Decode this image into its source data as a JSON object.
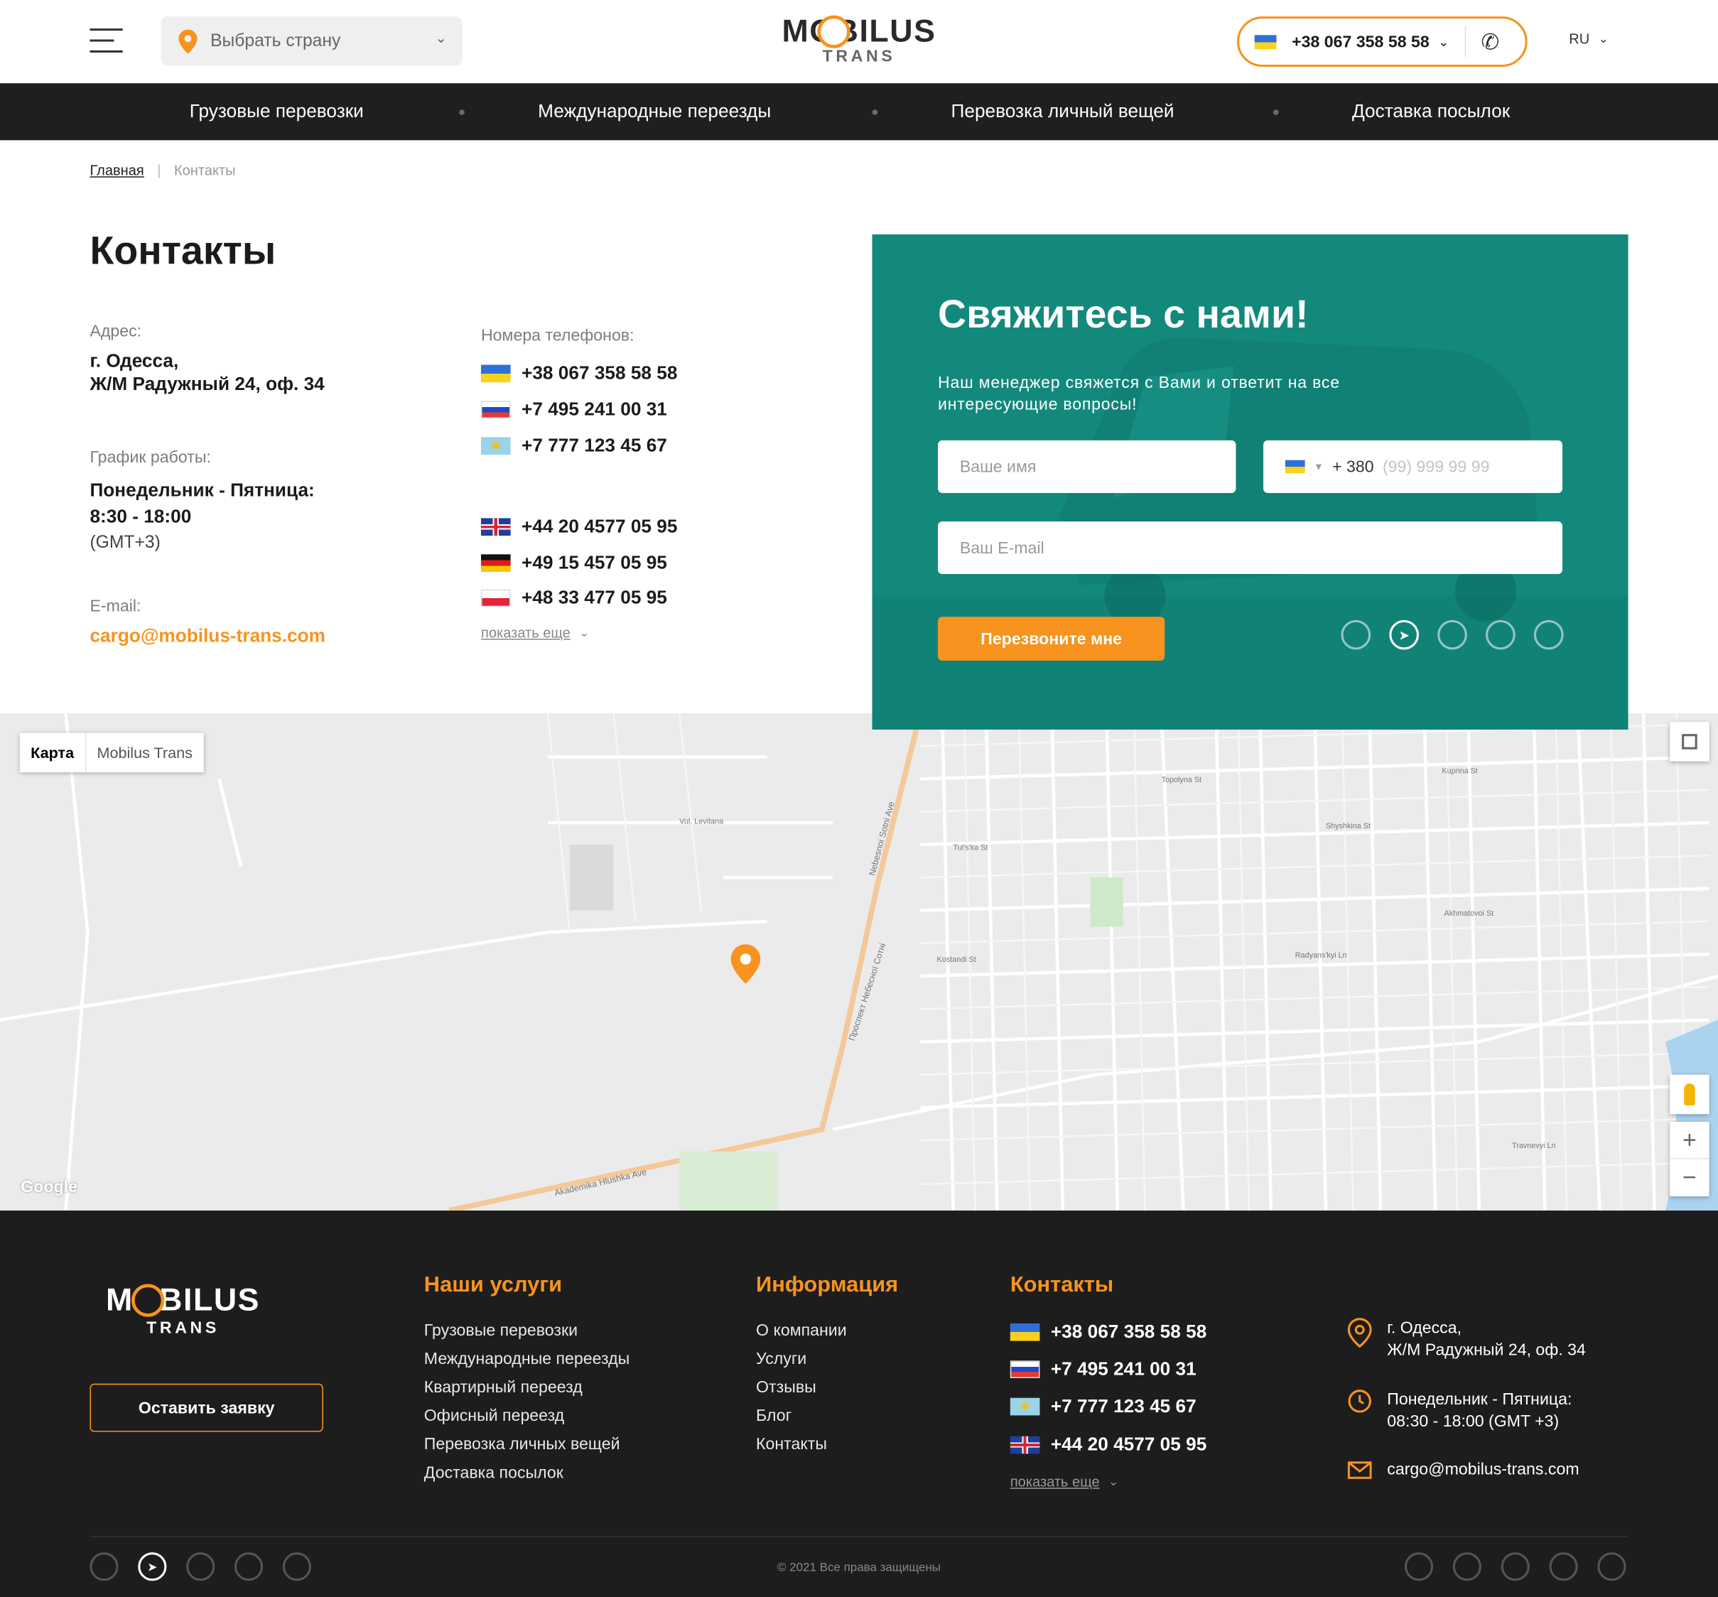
{
  "header": {
    "country_select": "Выбрать страну",
    "logo_main": "MOBILUS",
    "logo_sub": "TRANS",
    "phone": "+38 067 358 58 58",
    "lang": "RU"
  },
  "nav": [
    "Грузовые перевозки",
    "Международные переезды",
    "Перевозка личный вещей",
    "Доставка посылок"
  ],
  "breadcrumb": {
    "home": "Главная",
    "sep": "|",
    "current": "Контакты"
  },
  "page_title": "Контакты",
  "contacts": {
    "address_label": "Адрес:",
    "address_line1": "г. Одесса,",
    "address_line2": "Ж/М Радужный 24, оф. 34",
    "schedule_label": "График работы:",
    "schedule_days": "Понедельник - Пятница:",
    "schedule_hours": "8:30 - 18:00",
    "schedule_tz": "(GMT+3)",
    "email_label": "E-mail:",
    "email": "cargo@mobilus-trans.com",
    "phones_label": "Номера телефонов:",
    "phones": [
      {
        "flag": "ua",
        "number": "+38 067 358 58 58"
      },
      {
        "flag": "ru",
        "number": "+7 495 241 00 31"
      },
      {
        "flag": "kz",
        "number": "+7 777 123 45 67"
      },
      {
        "flag": "uk",
        "number": "+44 20 4577 05 95"
      },
      {
        "flag": "de",
        "number": "+49 15 457 05 95"
      },
      {
        "flag": "pl",
        "number": "+48 33 477 05 95"
      }
    ],
    "show_more": "показать еще"
  },
  "form": {
    "title": "Свяжитесь с нами!",
    "subtitle_line1": "Наш менеджер свяжется с Вами и ответит на все",
    "subtitle_line2": "интересующие вопросы!",
    "name_placeholder": "Ваше имя",
    "phone_prefix": "+ 380",
    "phone_placeholder": "(99) 999 99 99",
    "email_placeholder": "Ваш E-mail",
    "submit": "Перезвоните мне",
    "messengers": [
      "viber-icon",
      "telegram-icon",
      "whatsapp-icon",
      "messenger-icon",
      "skype-icon"
    ]
  },
  "map": {
    "tab_map": "Карта",
    "tab_place": "Mobilus Trans",
    "google": "Google",
    "zoom_in": "+",
    "zoom_out": "−",
    "streets": [
      "Akademika Hlushka Ave",
      "Nebesnoi Sotni Ave",
      "Проспект Небесної Сотні",
      "Akhmatovoi St",
      "Radyans'kyi Ln",
      "Kostandi St",
      "Tul's'ka St",
      "Topolyna St",
      "Vul. Levitana",
      "Travnevyi Ln",
      "Kuprina St",
      "Shyshkina St"
    ]
  },
  "footer": {
    "logo_main": "MOBILUS",
    "logo_sub": "TRANS",
    "cta": "Оставить заявку",
    "services_title": "Наши услуги",
    "services": [
      "Грузовые перевозки",
      "Международные переезды",
      "Квартирный перeезд",
      "Офисный переезд",
      "Перевозка личных вещей",
      "Доставка посылок"
    ],
    "info_title": "Информация",
    "info": [
      "О компании",
      "Услуги",
      "Отзывы",
      "Блог",
      "Контакты"
    ],
    "contacts_title": "Контакты",
    "phones": [
      {
        "flag": "ua",
        "number": "+38 067 358 58 58"
      },
      {
        "flag": "ru",
        "number": "+7 495 241 00 31"
      },
      {
        "flag": "kz",
        "number": "+7 777 123 45 67"
      },
      {
        "flag": "uk",
        "number": "+44 20 4577 05 95"
      }
    ],
    "show_more": "показать еще",
    "address_line1": "г. Одесса,",
    "address_line2": "Ж/М Радужный 24, оф. 34",
    "schedule_line1": "Понедельник - Пятница:",
    "schedule_line2": "08:30 - 18:00 (GMT +3)",
    "email": "cargo@mobilus-trans.com",
    "copyright": "© 2021 Все права защищены",
    "social": [
      "facebook-icon",
      "instagram-icon",
      "vk-icon",
      "youtube-icon",
      "odnoklassniki-icon"
    ]
  },
  "colors": {
    "accent": "#f7931e",
    "panel": "#13897c",
    "dark": "#1d1d1d"
  }
}
